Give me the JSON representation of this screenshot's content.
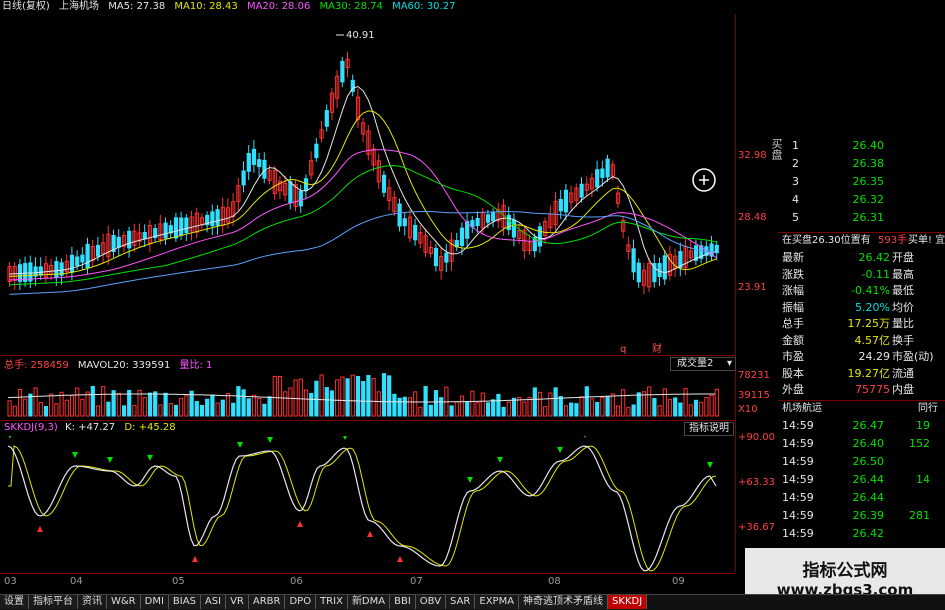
{
  "topbar": {
    "period": "日线(复权)",
    "name": "上海机场",
    "ma5": "MA5: 27.38",
    "ma10": "MA10: 28.43",
    "ma20": "MA20: 28.06",
    "ma30": "MA30: 28.74",
    "ma60": "MA60: 30.27"
  },
  "main": {
    "peak_label": "40.91",
    "y_labels": [
      "32.98",
      "28.48",
      "23.91"
    ],
    "footer_marks": [
      "q",
      "财"
    ]
  },
  "volume": {
    "total": "总手: 258459",
    "mavol": "MAVOL20: 339591",
    "ratio": "量比: 1",
    "dropdown": "成交量2",
    "y_labels": [
      "78231",
      "39115",
      "X10"
    ]
  },
  "kdj": {
    "name": "SKKDJ(9,3)",
    "k": "K: +47.27",
    "d": "D: +45.28",
    "help_btn": "指标说明",
    "y_labels": [
      "+90.00",
      "+63.33",
      "+36.67"
    ]
  },
  "x_labels": [
    "03",
    "04",
    "05",
    "06",
    "07",
    "08",
    "09"
  ],
  "orderbook": {
    "buy_label": "买盘",
    "bids": [
      {
        "level": "1",
        "price": "26.40",
        "vol": ""
      },
      {
        "level": "2",
        "price": "26.38",
        "vol": ""
      },
      {
        "level": "3",
        "price": "26.35",
        "vol": ""
      },
      {
        "level": "4",
        "price": "26.32",
        "vol": ""
      },
      {
        "level": "5",
        "price": "26.31",
        "vol": ""
      }
    ],
    "status_left": "在买盘26.30位置有",
    "status_mid": "593手",
    "status_right": "买单! 宜"
  },
  "quote": [
    {
      "label": "最新",
      "value": "26.42",
      "tag": "开盘",
      "vc": "green"
    },
    {
      "label": "涨跌",
      "value": "-0.11",
      "tag": "最高",
      "vc": "green"
    },
    {
      "label": "涨幅",
      "value": "-0.41%",
      "tag": "最低",
      "vc": "green"
    },
    {
      "label": "振幅",
      "value": "5.20%",
      "tag": "均价",
      "vc": "cyan"
    },
    {
      "label": "总手",
      "value": "17.25万",
      "tag": "量比",
      "vc": "yellow"
    },
    {
      "label": "金额",
      "value": "4.57亿",
      "tag": "换手",
      "vc": "yellow"
    },
    {
      "label": "市盈",
      "value": "24.29",
      "tag": "市盈(动)",
      "vc": "white"
    },
    {
      "label": "股本",
      "value": "19.27亿",
      "tag": "流通",
      "vc": "yellow"
    },
    {
      "label": "外盘",
      "value": "75775",
      "tag": "内盘",
      "vc": "red"
    }
  ],
  "news": {
    "left": "机场航运",
    "right": "同行"
  },
  "ticks": [
    {
      "time": "14:59",
      "price": "26.47",
      "vol": "19"
    },
    {
      "time": "14:59",
      "price": "26.40",
      "vol": "152"
    },
    {
      "time": "14:59",
      "price": "26.50",
      "vol": ""
    },
    {
      "time": "14:59",
      "price": "26.44",
      "vol": "14"
    },
    {
      "time": "14:59",
      "price": "26.44",
      "vol": ""
    },
    {
      "time": "14:59",
      "price": "26.39",
      "vol": "281"
    },
    {
      "time": "14:59",
      "price": "26.42",
      "vol": ""
    }
  ],
  "tabs": [
    "设置",
    "指标平台",
    "资讯",
    "W&R",
    "DMI",
    "BIAS",
    "ASI",
    "VR",
    "ARBR",
    "DPO",
    "TRIX",
    "新DMA",
    "BBI",
    "OBV",
    "SAR",
    "EXPMA",
    "神奇逃顶术矛盾线",
    "SKKDJ"
  ],
  "watermark": {
    "line1": "指标公式网",
    "line2": "www.zbgs3.com"
  }
}
